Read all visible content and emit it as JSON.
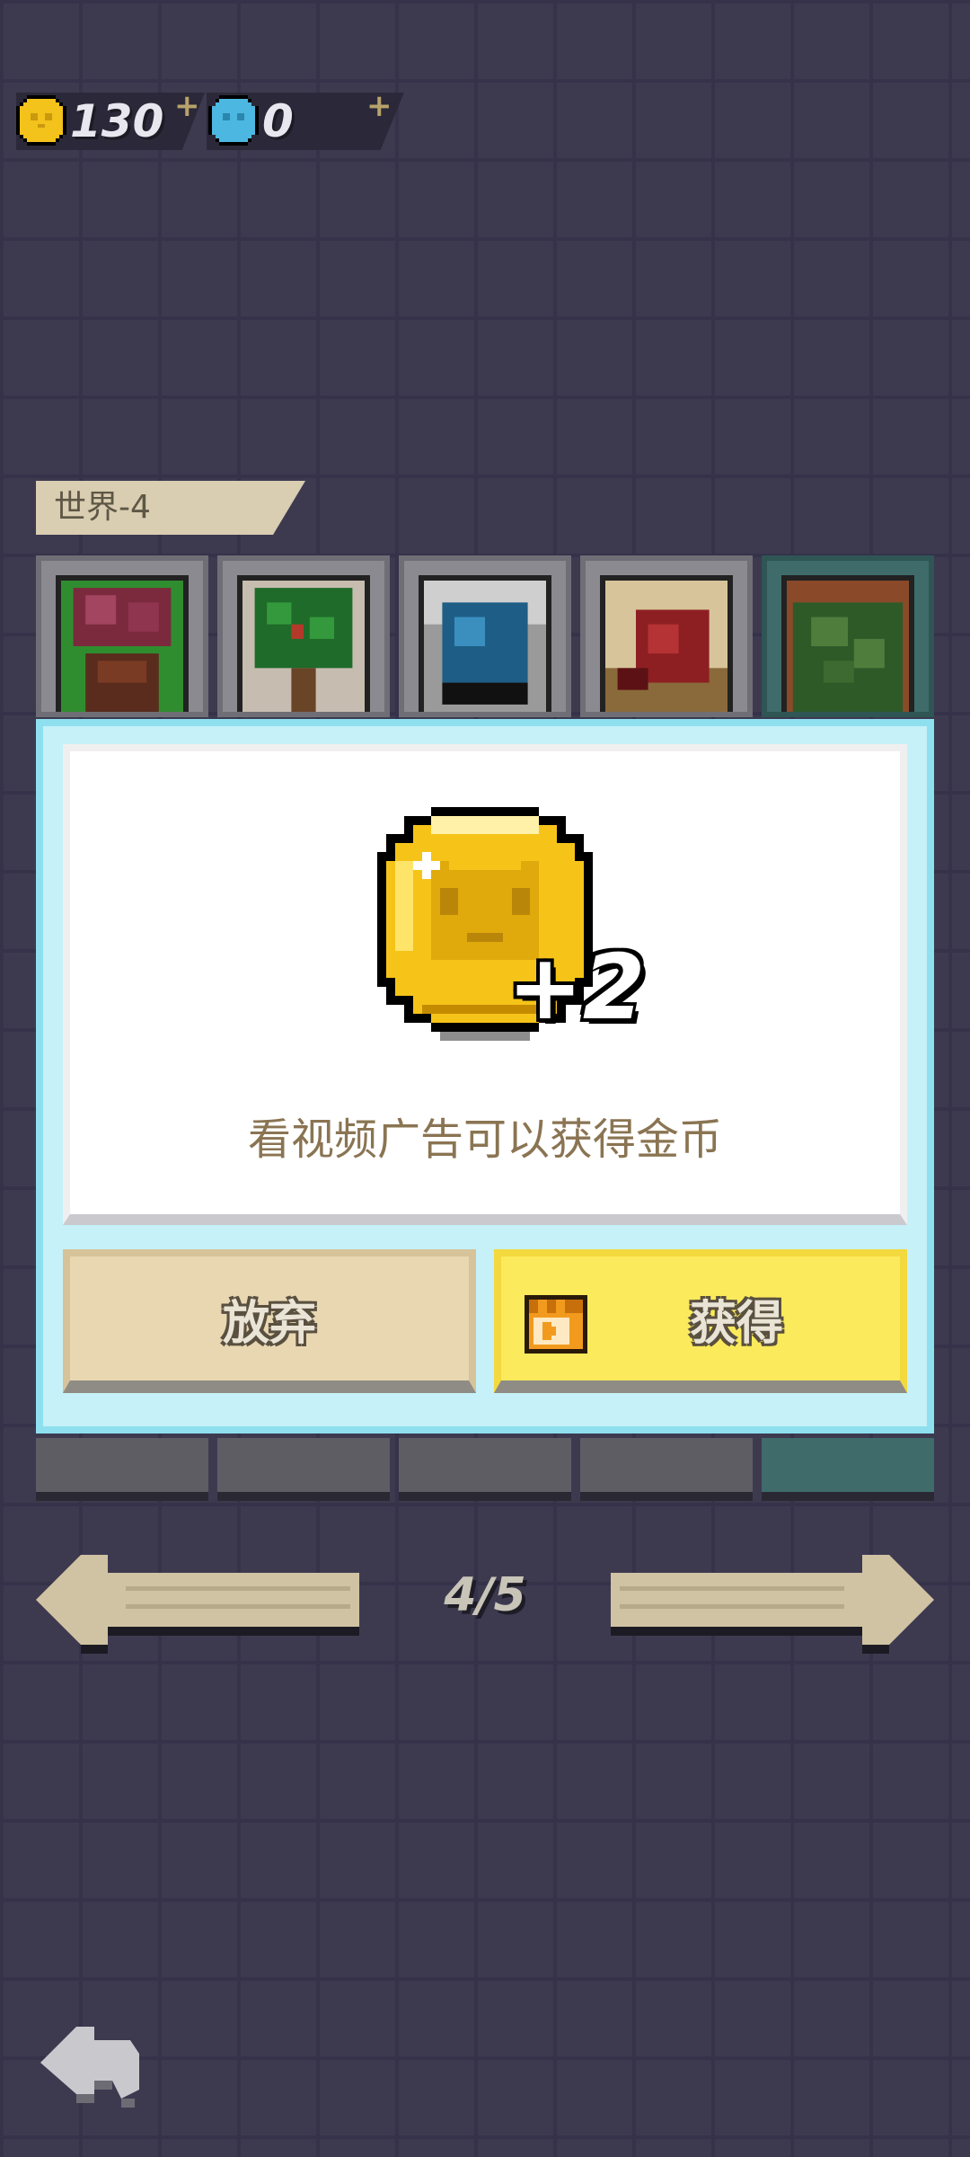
{
  "currency": {
    "coins": "130",
    "gems": "0",
    "plus_symbol": "+"
  },
  "world": {
    "label": "世界-4"
  },
  "levels": [
    {
      "name": "level-1",
      "theme": "red-flower-pot"
    },
    {
      "name": "level-2",
      "theme": "green-tree"
    },
    {
      "name": "level-3",
      "theme": "blue-crystal"
    },
    {
      "name": "level-4",
      "theme": "red-meat"
    },
    {
      "name": "level-5",
      "theme": "green-bush",
      "selected": true
    }
  ],
  "dialog": {
    "reward_amount": "+2",
    "message": "看视频广告可以获得金币",
    "abandon_label": "放弃",
    "obtain_label": "获得",
    "reward_icon": "gold-coin-icon",
    "obtain_icon": "video-ad-icon"
  },
  "pager": {
    "indicator": "4/5"
  },
  "colors": {
    "background": "#3d3a50",
    "modal_border": "#8ee0ef",
    "obtain_button": "#fbea5b",
    "abandon_button": "#e8d7b1"
  }
}
